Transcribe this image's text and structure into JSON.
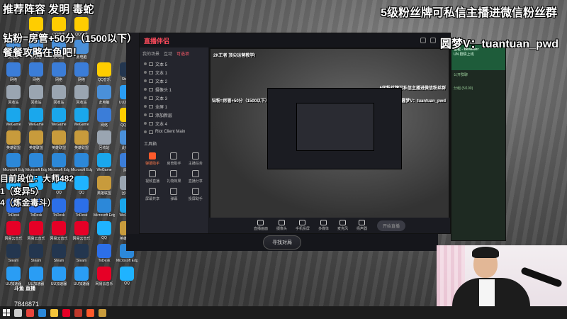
{
  "overlay": {
    "top_left_line1": "推荐阵容  发明  毒蛇",
    "top_left_line2": "钻粉=房管+50分（1500以下）",
    "top_left_line3": "餐餐攻略在鱼吧！",
    "top_right_line1": "5级粉丝牌可私信主播进微信粉丝群",
    "top_right_line2": "圆梦V：tuantuan_pwd",
    "rank_line1": "目前段位：大师482",
    "rank_line2": "1（变异5）",
    "rank_line3": "4（炼金毒斗）"
  },
  "desktop_icons": [
    {
      "label": "此电脑",
      "color": "#4a90d9"
    },
    {
      "label": "网络",
      "color": "#3b7dd8"
    },
    {
      "label": "回收站",
      "color": "#9aa5b1"
    },
    {
      "label": "WeGame",
      "color": "#1aa7ec"
    },
    {
      "label": "英雄联盟",
      "color": "#c89b3c"
    },
    {
      "label": "Microsoft Edge",
      "color": "#2c88d9"
    },
    {
      "label": "QQ",
      "color": "#1fb3ff"
    },
    {
      "label": "ToDesk",
      "color": "#2c6fe8"
    },
    {
      "label": "网易云音乐",
      "color": "#e60026"
    },
    {
      "label": "Steam",
      "color": "#23364f"
    },
    {
      "label": "UU加速器",
      "color": "#2a9df4"
    },
    {
      "label": "QQ音乐",
      "color": "#ffcd00"
    }
  ],
  "app": {
    "logo": "直播伴侣",
    "tabs": [
      "我的场景",
      "互动",
      "可选项"
    ],
    "scenes": [
      "文本 5",
      "文本 1",
      "文本 2",
      "摄像头 1",
      "文本 3",
      "全屏 1",
      "添加新层",
      "文本 4",
      "Riot Client Main"
    ],
    "tools_label": "工具箱",
    "tools": [
      {
        "label": "弹幕助手",
        "hot": true
      },
      {
        "label": "房管助手",
        "hot": false
      },
      {
        "label": "主播任务",
        "hot": false
      },
      {
        "label": "视频直播",
        "hot": false
      },
      {
        "label": "礼物效果",
        "hot": false
      },
      {
        "label": "直播分享",
        "hot": false
      },
      {
        "label": "屏幕共享",
        "hot": false
      },
      {
        "label": "弹幕",
        "hot": false
      },
      {
        "label": "投屏助手",
        "hot": false
      }
    ],
    "preview_title": "2K王者 顶尖运营教学!",
    "preview_buttons": [
      "直播画面",
      "摄像头",
      "手机投屏",
      "多媒体",
      "麦克风",
      "扬声器"
    ],
    "go_live": "开始直播",
    "bottom_button": "寻找对局",
    "preview_overlay1": "钻粉=房管+50分（1500以下）",
    "preview_overlay2": "5级粉丝牌可私信主播进微信粉丝群",
    "preview_overlay3": "圆梦V：tuantuan_pwd"
  },
  "chat": {
    "name": "雪花 - Bewilder",
    "sub": "UN 剧情上线",
    "line1": "公开群聊",
    "line2": "分组 (5/100)"
  },
  "logo_badge": "斗鱼 直播",
  "room_id": "7846871",
  "taskbar_icons": [
    {
      "name": "start",
      "color": "#ffffff"
    },
    {
      "name": "search",
      "color": "#cccccc"
    },
    {
      "name": "chrome",
      "color": "#e8453c"
    },
    {
      "name": "edge",
      "color": "#2c88d9"
    },
    {
      "name": "explorer",
      "color": "#f3c33b"
    },
    {
      "name": "netease",
      "color": "#e60026"
    },
    {
      "name": "app",
      "color": "#c0392b"
    },
    {
      "name": "wegame",
      "color": "#ff5a2b"
    },
    {
      "name": "lol",
      "color": "#c89b3c"
    }
  ]
}
